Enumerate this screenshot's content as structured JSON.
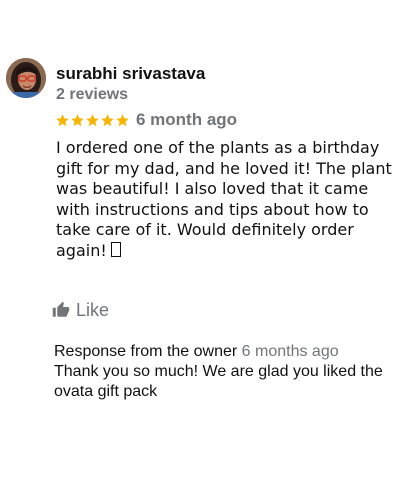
{
  "review": {
    "reviewer_name": "surabhi srivastava",
    "review_count": "2 reviews",
    "rating": 5,
    "rating_max": 5,
    "star_color": "#f4b400",
    "date": "6 month ago",
    "text": "I ordered one of the plants as a birthday gift for my dad, and he loved it! The plant was beautiful! I also loved that it came with instructions and tips about how to take care of it. Would definitely order again!",
    "emoji_icon": "unrendered-emoji-icon",
    "like_label": "Like",
    "like_icon": "thumbs-up-icon"
  },
  "owner_response": {
    "label": "Response from the owner",
    "date": "6 months ago",
    "text": "Thank you so much! We are glad you liked the ovata gift pack"
  }
}
